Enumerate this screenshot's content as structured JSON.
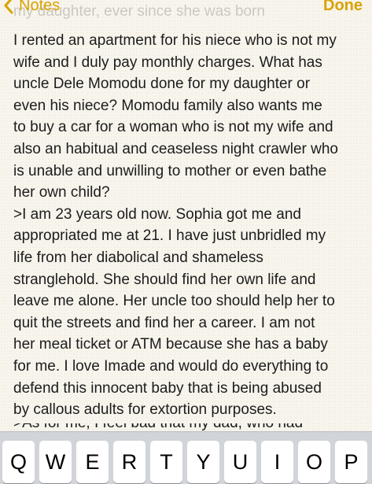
{
  "nav": {
    "back_label": "Notes",
    "done_label": "Done"
  },
  "note": {
    "faded_line": "my daughter, ever since she was born",
    "lines": [
      "I rented an apartment for his niece who is not my",
      "wife and I duly pay monthly charges. What has",
      "uncle Dele Momodu done for my daughter or",
      "even his niece?  Momodu  family also wants me",
      "to buy a car for a woman who is not my wife and",
      "also an habitual and ceaseless night crawler who",
      "is unable and unwilling to mother or even bathe",
      "her own child?",
      ">I am 23 years old now. Sophia got me and",
      "appropriated me at 21. I have just unbridled my",
      "life from her diabolical and shameless",
      "stranglehold. She should find her own life and",
      "leave me alone. Her uncle too should help her to",
      "quit the streets and find her a career. I am not",
      "her meal ticket or ATM because she has a baby",
      "for me. I love Imade and would do everything to",
      "defend this innocent baby that is being abused",
      "by callous adults for extortion purposes."
    ],
    "cut_line": ">As for me, I feel bad that my dad, who had"
  },
  "keyboard": {
    "keys": [
      "Q",
      "W",
      "E",
      "R",
      "T",
      "Y",
      "U",
      "I",
      "O",
      "P"
    ]
  },
  "colors": {
    "accent": "#d8a300",
    "paper": "#f8f5ed",
    "text": "#1c1c1c",
    "keyboard_bg": "#d1d4d9"
  }
}
